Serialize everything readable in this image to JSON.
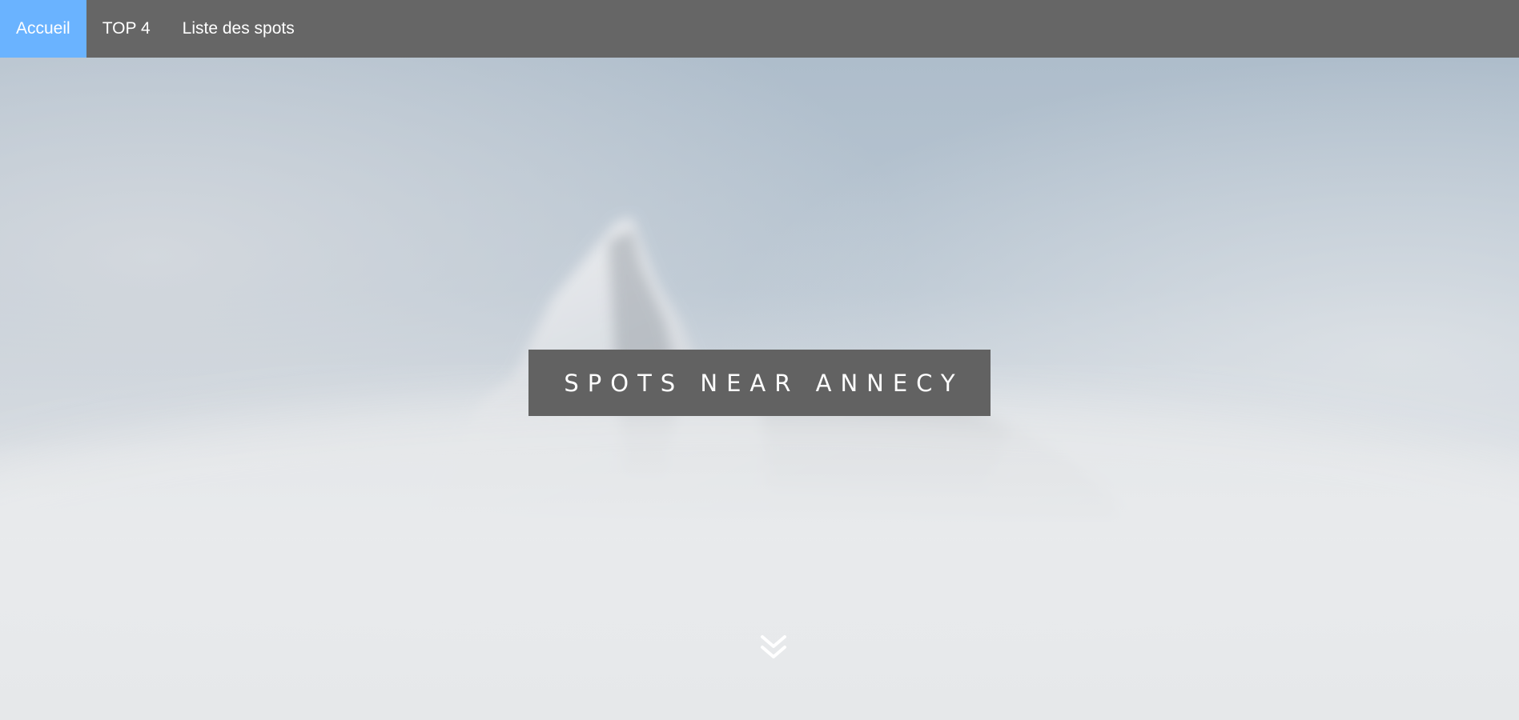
{
  "nav": {
    "items": [
      {
        "label": "Accueil",
        "active": true
      },
      {
        "label": "TOP 4",
        "active": false
      },
      {
        "label": "Liste des spots",
        "active": false
      }
    ]
  },
  "hero": {
    "title": "SPOTS NEAR ANNECY",
    "scroll_icon": "double-chevron-down-icon",
    "background_image": "misty-mountain-peak"
  },
  "colors": {
    "navbar_bg": "#666666",
    "active_tab_bg": "#6ab3ff",
    "title_box_bg": "#626262",
    "text": "#ffffff"
  }
}
